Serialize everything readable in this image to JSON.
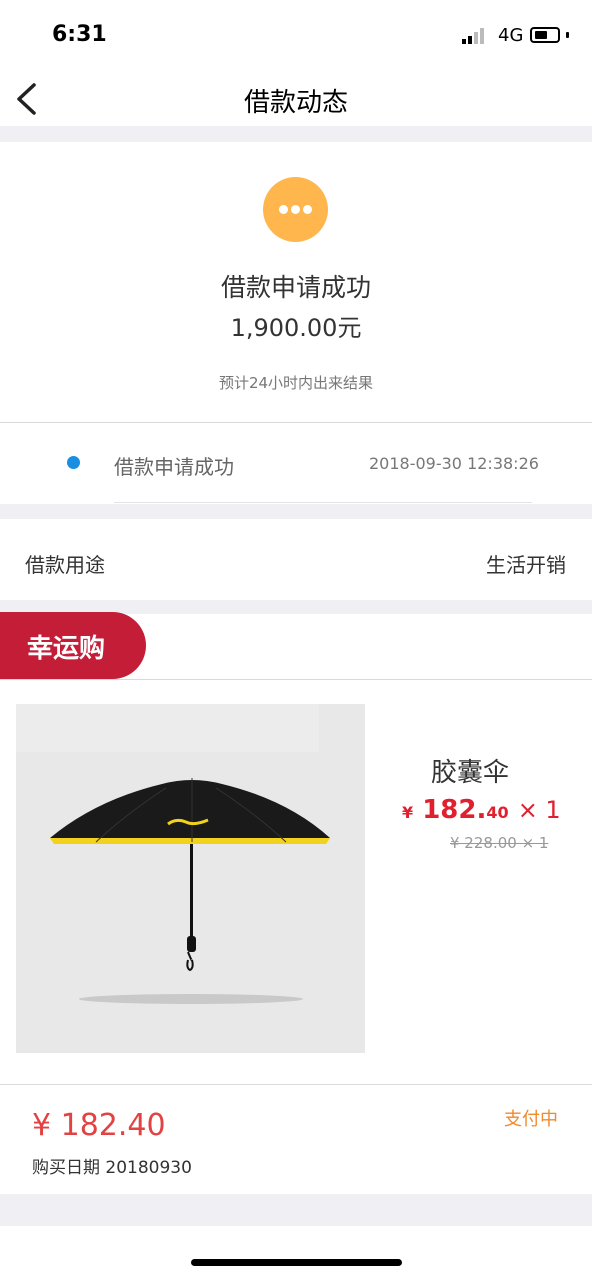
{
  "status_bar": {
    "time": "6:31",
    "network": "4G"
  },
  "nav": {
    "title": "借款动态",
    "back_icon": "chevron-left-icon"
  },
  "loan_status": {
    "icon": "more-dots-icon",
    "icon_color": "#ffb74d",
    "title": "借款申请成功",
    "amount": "1,900.00元",
    "estimate": "预计24小时内出来结果"
  },
  "timeline": [
    {
      "label": "借款申请成功",
      "time": "2018-09-30 12:38:26",
      "dot_color": "#1a8ee0"
    }
  ],
  "purpose": {
    "label": "借款用途",
    "value": "生活开销"
  },
  "lucky_buy": {
    "badge": "幸运购",
    "badge_color": "#c41d38",
    "product": {
      "image": "umbrella-image",
      "name": "胶囊伞",
      "price_symbol": "¥",
      "price_integer": "182.",
      "price_decimal": "40",
      "quantity": "× 1",
      "original_price": "¥ 228.00 × 1"
    },
    "total": "¥ 182.40",
    "status": "支付中",
    "status_color": "#f08a2c",
    "purchase_date": "购买日期 20180930"
  }
}
